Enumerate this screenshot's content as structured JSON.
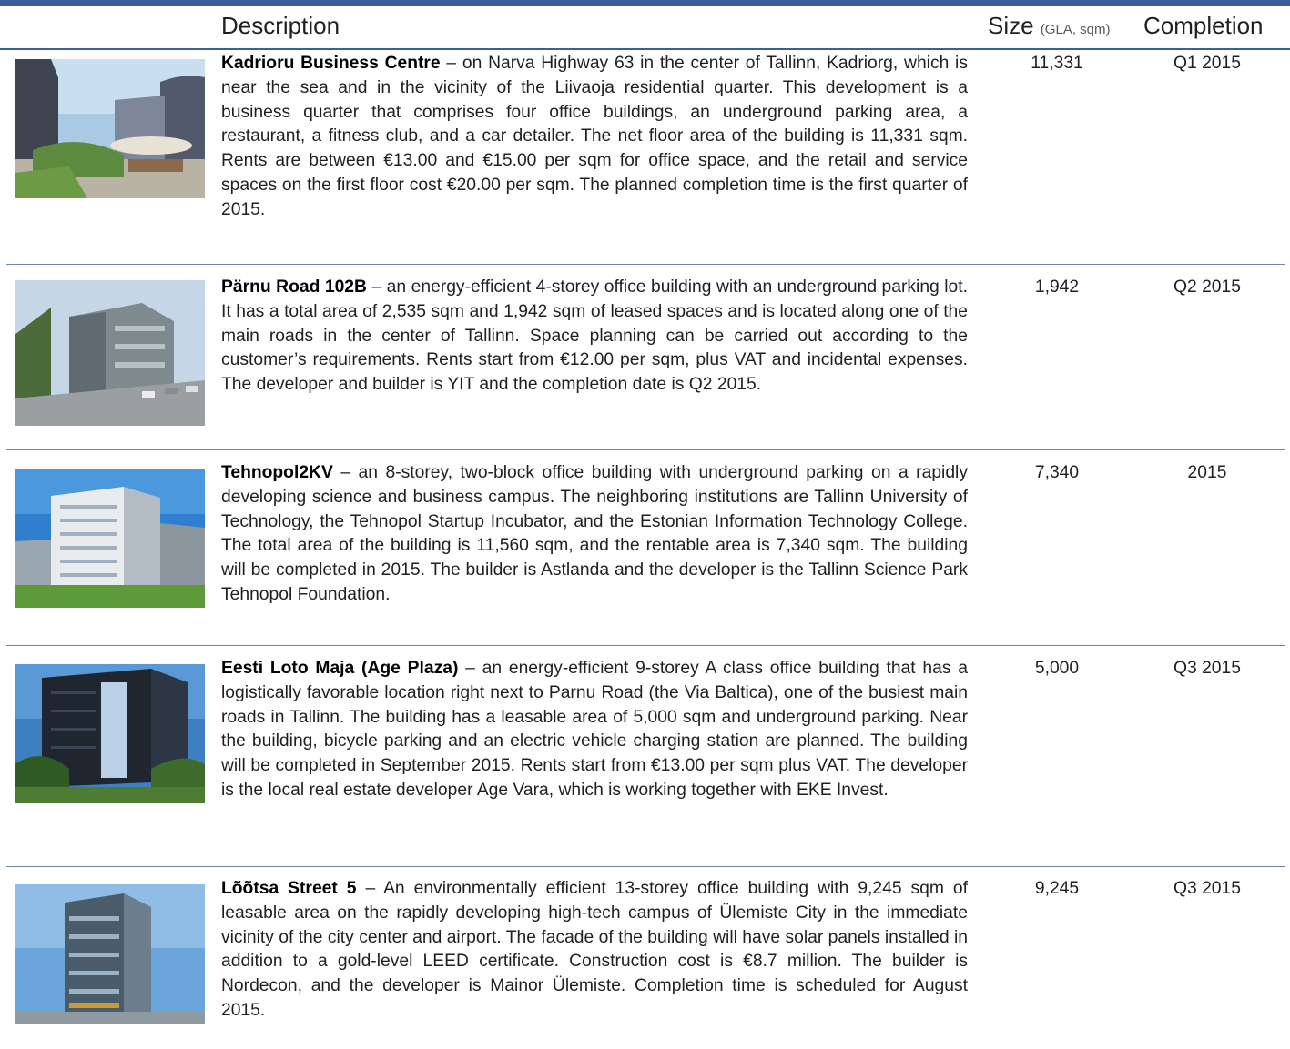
{
  "header": {
    "description": "Description",
    "size": "Size",
    "size_unit": "(GLA, sqm)",
    "completion": "Completion"
  },
  "rows": [
    {
      "name": "Kadrioru Business Centre",
      "text": " – on Narva Highway 63 in the center of Tallinn, Kadriorg, which is near the sea and in the vicinity of the Liivaoja residential quarter. This development is a business quarter that comprises four office buildings, an underground parking area, a restaurant, a fitness club, and a car detailer. The net floor area of the building is 11,331 sqm. Rents are between €13.00 and €15.00 per sqm for office space, and the retail and service spaces on the first floor cost €20.00 per sqm. The planned completion time is the first quarter of 2015.",
      "size": "11,331",
      "completion": "Q1 2015"
    },
    {
      "name": "Pärnu Road 102B",
      "text": "  – an energy-efficient 4-storey office building with an underground parking lot. It has a total area of 2,535 sqm and 1,942 sqm of leased spaces and is located along one of the main roads in the center of Tallinn. Space planning can be carried out according to the customer’s requirements. Rents start from €12.00 per sqm, plus VAT and incidental expenses. The developer and builder is YIT and the completion date is Q2 2015.",
      "size": "1,942",
      "completion": "Q2 2015"
    },
    {
      "name": "Tehnopol2KV",
      "text": " – an 8-storey, two-block office building with underground parking on a rapidly developing science and business campus. The neighboring institutions are Tallinn University of Technology, the Tehnopol Startup Incubator, and the Estonian Information Technology College. The total area of the building is 11,560 sqm, and the rentable area is 7,340 sqm. The building will be completed in 2015. The builder is Astlanda and the developer is the Tallinn Science Park Tehnopol Foundation.",
      "size": "7,340",
      "completion": "2015"
    },
    {
      "name": "Eesti Loto Maja (Age Plaza)",
      "text": " – an energy-efficient 9-storey A class office building that has a logistically favorable location right next to Parnu Road (the Via Baltica), one of the busiest main roads in Tallinn. The building has a leasable area of 5,000 sqm and underground parking. Near the building, bicycle parking and an electric vehicle charging station are planned. The building will be completed in September 2015. Rents start from €13.00 per sqm plus VAT. The developer is the local real estate developer Age Vara, which is working together with EKE Invest.",
      "size": "5,000",
      "completion": "Q3 2015"
    },
    {
      "name": "Lõõtsa Street 5",
      "text": " – An environmentally efficient 13-storey office building with 9,245 sqm of leasable area on the rapidly developing high-tech campus of Ülemiste City in the immediate vicinity of the city center and airport. The facade of the building will have solar panels installed in addition to a gold-level LEED certificate. Construction cost is €8.7 million. The builder is Nordecon, and the developer is Mainor Ülemiste. Completion time is scheduled for August 2015.",
      "size": "9,245",
      "completion": "Q3 2015"
    }
  ]
}
